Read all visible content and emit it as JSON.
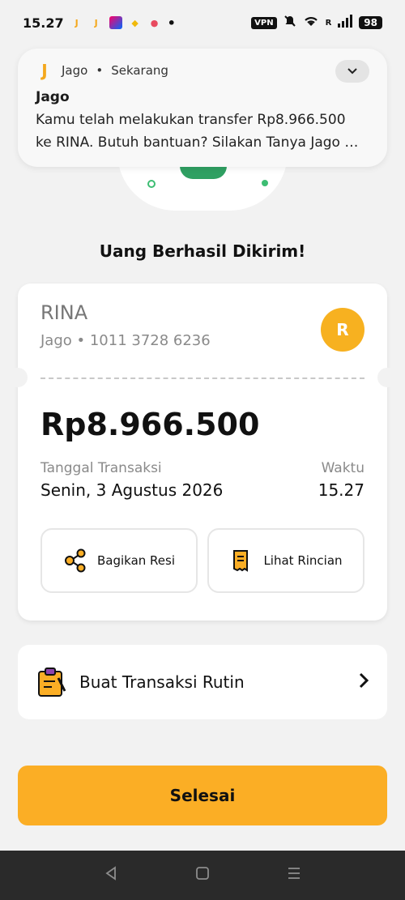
{
  "status_bar": {
    "time": "15.27",
    "vpn": "VPN",
    "network": "R",
    "battery": "98"
  },
  "notification": {
    "app": "Jago",
    "when": "Sekarang",
    "title": "Jago",
    "line1": "Kamu telah melakukan transfer Rp8.966.500",
    "line2": "ke RINA. Butuh bantuan? Silakan Tanya Jago …"
  },
  "headline": "Uang Berhasil Dikirim!",
  "recipient": {
    "name": "RINA",
    "account": "Jago • 1011 3728 6236",
    "initial": "R"
  },
  "amount": "Rp8.966.500",
  "date_label": "Tanggal Transaksi",
  "date_value": "Senin, 3 Agustus 2026",
  "time_label": "Waktu",
  "time_value": "15.27",
  "actions": {
    "share": "Bagikan Resi",
    "detail": "Lihat Rincian"
  },
  "routine": "Buat Transaksi Rutin",
  "done": "Selesai",
  "colors": {
    "accent": "#fbae25",
    "green": "#3dbd73"
  }
}
